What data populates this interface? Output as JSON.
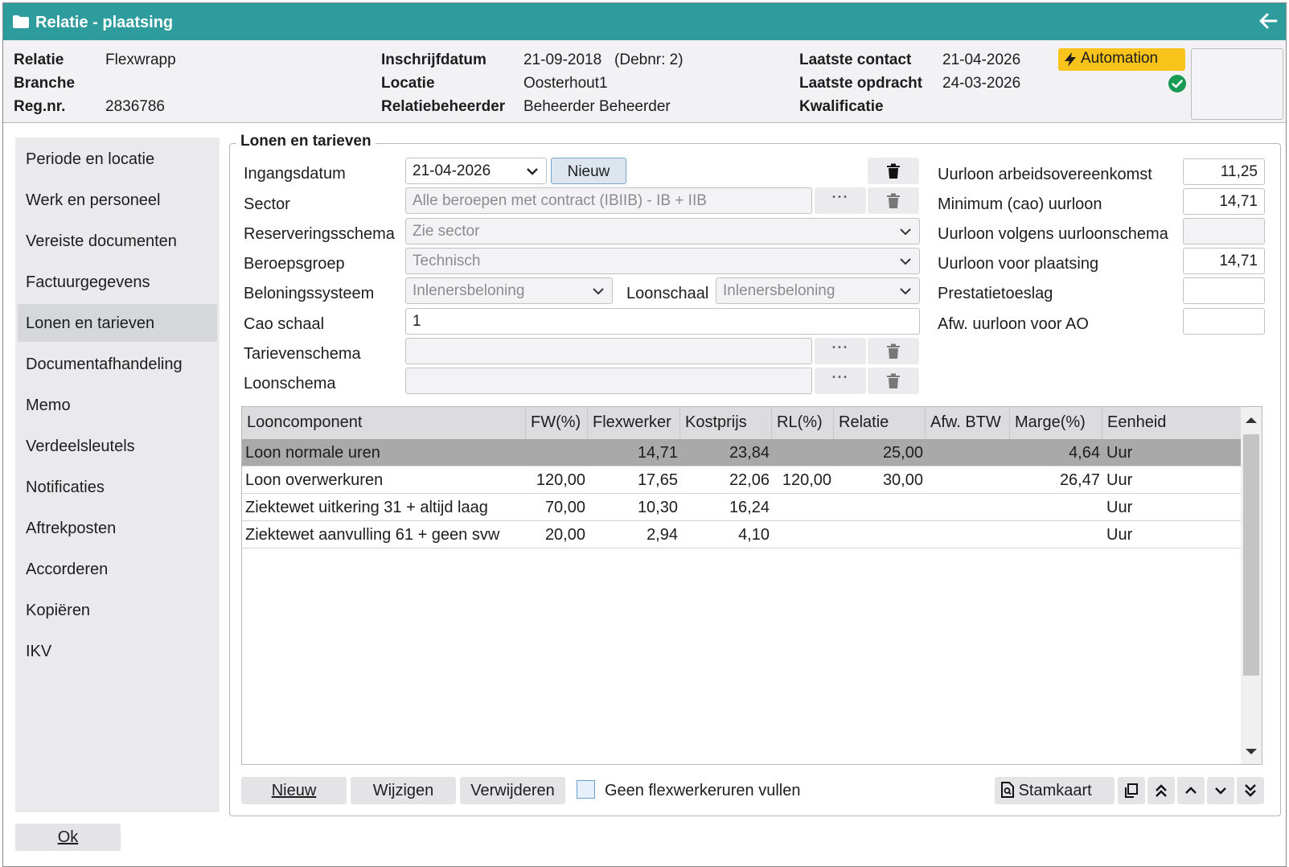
{
  "window": {
    "title": "Relatie - plaatsing"
  },
  "header": {
    "relatie_label": "Relatie",
    "relatie_value": "Flexwrapp",
    "branche_label": "Branche",
    "branche_value": "",
    "regnr_label": "Reg.nr.",
    "regnr_value": "2836786",
    "inschrijfdatum_label": "Inschrijfdatum",
    "inschrijfdatum_value": "21-09-2018   (Debnr: 2)",
    "locatie_label": "Locatie",
    "locatie_value": "Oosterhout1",
    "relatiebeheerder_label": "Relatiebeheerder",
    "relatiebeheerder_value": "Beheerder Beheerder",
    "laatste_contact_label": "Laatste contact",
    "laatste_contact_value": "21-04-2026",
    "laatste_opdracht_label": "Laatste opdracht",
    "laatste_opdracht_value": "24-03-2026",
    "kwalificatie_label": "Kwalificatie",
    "kwalificatie_value": "",
    "automation_label": "Automation"
  },
  "sidebar": {
    "items": [
      {
        "label": "Periode en locatie"
      },
      {
        "label": "Werk en personeel"
      },
      {
        "label": "Vereiste documenten"
      },
      {
        "label": "Factuurgegevens"
      },
      {
        "label": "Lonen en tarieven"
      },
      {
        "label": "Documentafhandeling"
      },
      {
        "label": "Memo"
      },
      {
        "label": "Verdeelsleutels"
      },
      {
        "label": "Notificaties"
      },
      {
        "label": "Aftrekposten"
      },
      {
        "label": "Accorderen"
      },
      {
        "label": "Kopiëren"
      },
      {
        "label": "IKV"
      }
    ],
    "active_index": 4
  },
  "form": {
    "group_title": "Lonen en tarieven",
    "ingangsdatum_label": "Ingangsdatum",
    "ingangsdatum_value": "21-04-2026",
    "nieuw_label": "Nieuw",
    "sector_label": "Sector",
    "sector_value": "Alle beroepen met contract (IBIIB) - IB + IIB",
    "reserveringsschema_label": "Reserveringsschema",
    "reserveringsschema_value": "Zie sector",
    "beroepsgroep_label": "Beroepsgroep",
    "beroepsgroep_value": "Technisch",
    "beloningssysteem_label": "Beloningssysteem",
    "beloningssysteem_value": "Inlenersbeloning",
    "loonschaal_label": "Loonschaal",
    "loonschaal_value": "Inlenersbeloning",
    "cao_schaal_label": "Cao schaal",
    "cao_schaal_value": "1",
    "tarievenschema_label": "Tarievenschema",
    "tarievenschema_value": "",
    "loonschema_label": "Loonschema",
    "loonschema_value": "",
    "dots": "···"
  },
  "rates": {
    "uurloon_ao_label": "Uurloon arbeidsovereenkomst",
    "uurloon_ao_value": "11,25",
    "min_cao_label": "Minimum (cao) uurloon",
    "min_cao_value": "14,71",
    "uurloonschema_label": "Uurloon volgens uurloonschema",
    "uurloonschema_value": "",
    "uurloon_plaatsing_label": "Uurloon voor plaatsing",
    "uurloon_plaatsing_value": "14,71",
    "prestatietoeslag_label": "Prestatietoeslag",
    "prestatietoeslag_value": "",
    "afw_uurloon_label": "Afw. uurloon voor AO",
    "afw_uurloon_value": ""
  },
  "table": {
    "columns": [
      "Looncomponent",
      "FW(%)",
      "Flexwerker",
      "Kostprijs",
      "RL(%)",
      "Relatie",
      "Afw. BTW",
      "Marge(%)",
      "Eenheid"
    ],
    "rows": [
      [
        "Loon normale uren",
        "",
        "14,71",
        "23,84",
        "",
        "25,00",
        "",
        "4,64",
        "Uur"
      ],
      [
        "Loon overwerkuren",
        "120,00",
        "17,65",
        "22,06",
        "120,00",
        "30,00",
        "",
        "26,47",
        "Uur"
      ],
      [
        "Ziektewet uitkering 31 + altijd laag",
        "70,00",
        "10,30",
        "16,24",
        "",
        "",
        "",
        "",
        "Uur"
      ],
      [
        "Ziektewet aanvulling 61 +  geen svw",
        "20,00",
        "2,94",
        "4,10",
        "",
        "",
        "",
        "",
        "Uur"
      ]
    ],
    "selected_index": 0
  },
  "footer": {
    "nieuw_label": "Nieuw",
    "wijzigen_label": "Wijzigen",
    "verwijderen_label": "Verwijderen",
    "geen_flex_label": "Geen flexwerkeruren vullen",
    "stamkaart_label": "Stamkaart",
    "ok_label": "Ok"
  },
  "colors": {
    "titlebar": "#2e9c9d",
    "automation_badge": "#f8c31a",
    "check": "#1a9b54"
  }
}
